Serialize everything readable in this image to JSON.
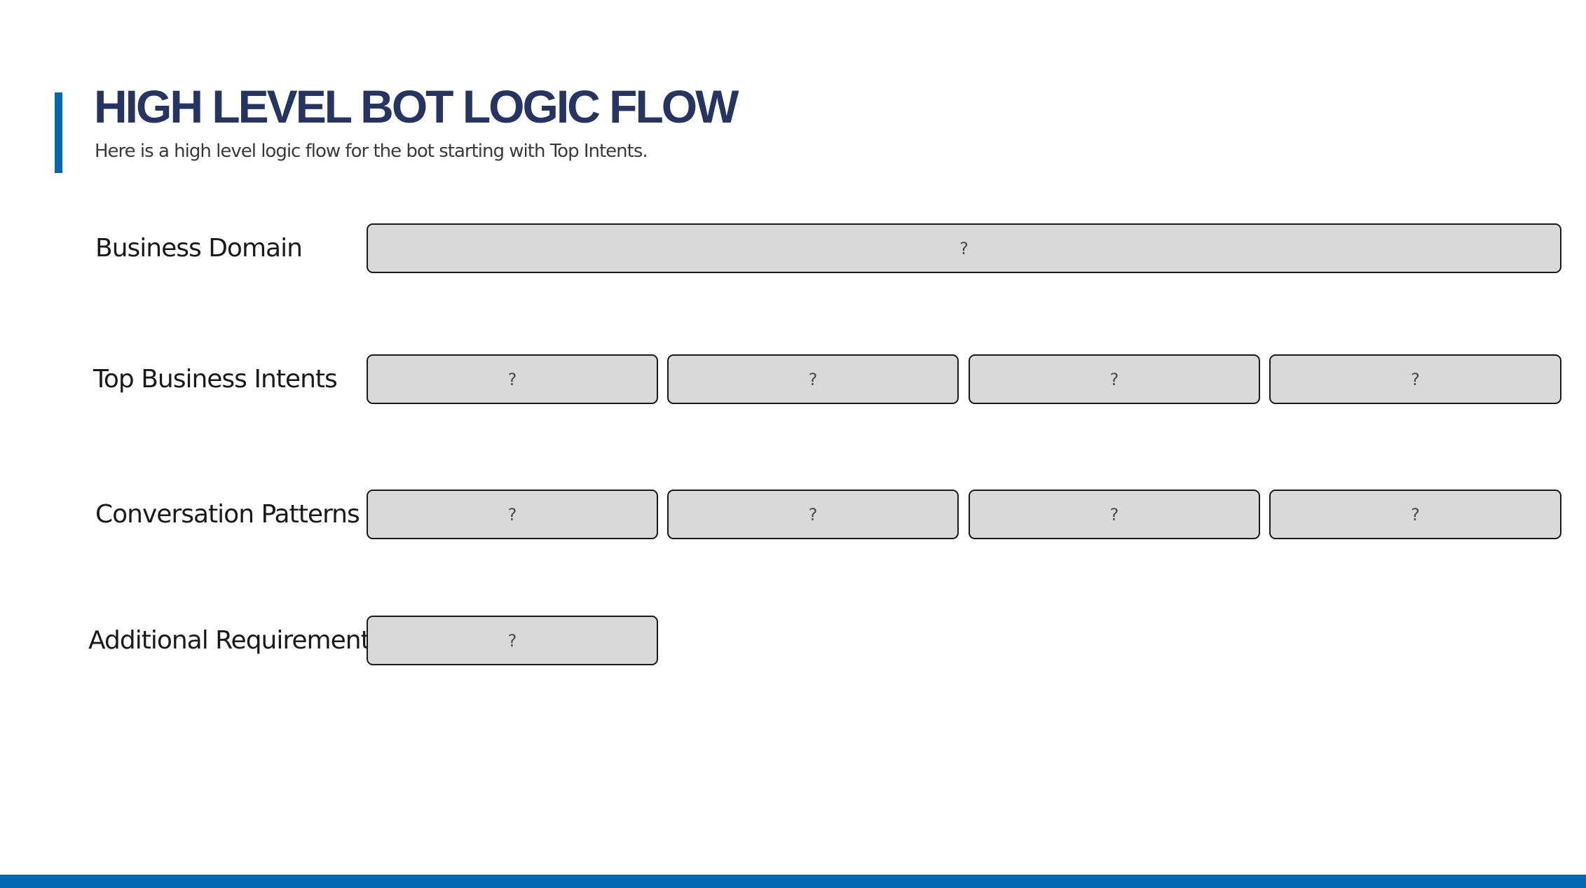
{
  "header": {
    "title": "HIGH LEVEL BOT LOGIC FLOW",
    "subtitle": "Here is a high level logic flow for the bot starting with Top Intents."
  },
  "rows": [
    {
      "label": "Business Domain",
      "boxes": [
        "?"
      ]
    },
    {
      "label": "Top Business Intents",
      "boxes": [
        "?",
        "?",
        "?",
        "?"
      ]
    },
    {
      "label": "Conversation Patterns",
      "boxes": [
        "?",
        "?",
        "?",
        "?"
      ]
    },
    {
      "label": "Additional Requirements",
      "boxes": [
        "?"
      ]
    }
  ],
  "colors": {
    "title": "#253461",
    "accent": "#0467b0",
    "box_fill": "#d9d9d9",
    "box_border": "#1a1a1a"
  }
}
